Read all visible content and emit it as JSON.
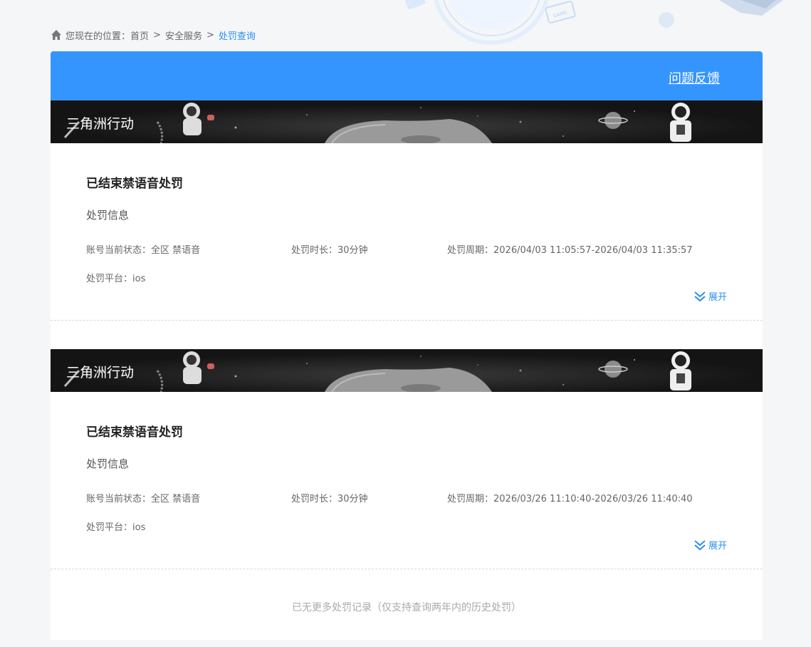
{
  "breadcrumb": {
    "prefix": "您现在的位置：",
    "items": [
      "首页",
      "安全服务"
    ],
    "separator": ">",
    "current": "处罚查询"
  },
  "header": {
    "feedback_label": "问题反馈",
    "accent_color": "#3595ff"
  },
  "records": [
    {
      "game": "三角洲行动",
      "title": "已结束禁语音处罚",
      "section": "处罚信息",
      "status": "账号当前状态：全区 禁语音",
      "duration": "处罚时长：30分钟",
      "period": "处罚周期：2026/04/03 11:05:57-2026/04/03 11:35:57",
      "platform": "处罚平台：ios",
      "expand_label": "展开"
    },
    {
      "game": "三角洲行动",
      "title": "已结束禁语音处罚",
      "section": "处罚信息",
      "status": "账号当前状态：全区 禁语音",
      "duration": "处罚时长：30分钟",
      "period": "处罚周期：2026/03/26 11:10:40-2026/03/26 11:40:40",
      "platform": "处罚平台：ios",
      "expand_label": "展开"
    }
  ],
  "footer_note": "已无更多处罚记录（仅支持查询两年内的历史处罚）"
}
